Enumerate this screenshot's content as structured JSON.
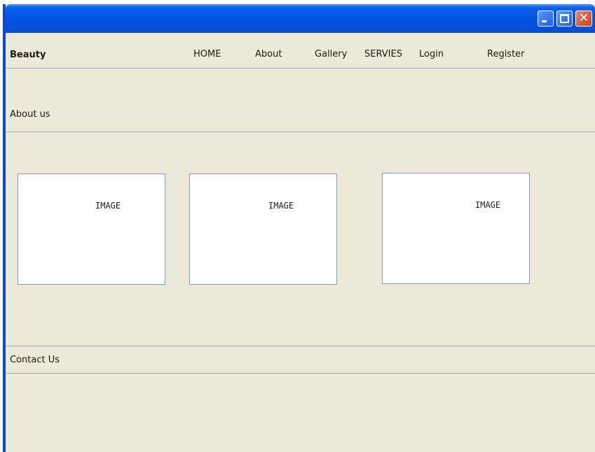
{
  "window": {
    "controls": {
      "minimize": "minimize-icon",
      "maximize": "maximize-icon",
      "close": "close-icon",
      "close_glyph": "✕"
    },
    "colors": {
      "titlebar": "#0454e3",
      "client_bg": "#ece9d8",
      "close_button": "#c9431d",
      "border_accent": "#0a49d6"
    }
  },
  "header": {
    "brand": "Beauty",
    "nav": [
      "HOME",
      "About",
      "Gallery",
      "SERVIES",
      "Login",
      "Register"
    ]
  },
  "about": {
    "heading": "About us",
    "images": [
      {
        "label": "IMAGE"
      },
      {
        "label": "IMAGE"
      },
      {
        "label": "IMAGE"
      }
    ]
  },
  "contact": {
    "heading": "Contact Us"
  }
}
